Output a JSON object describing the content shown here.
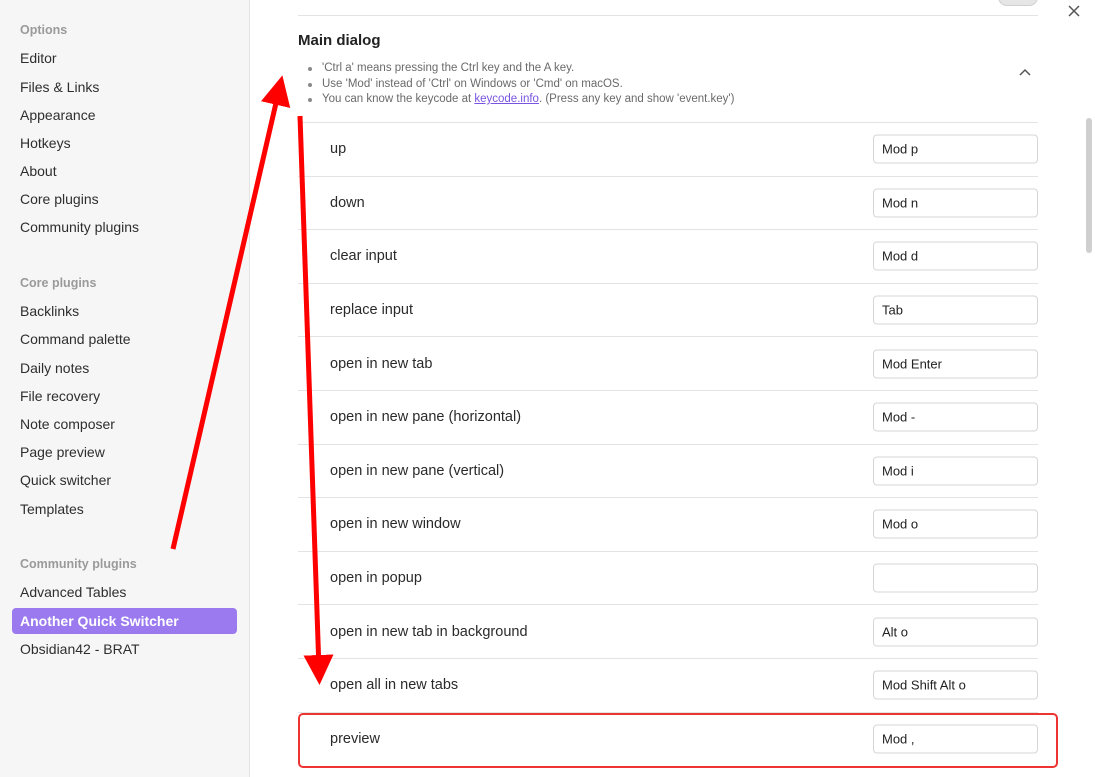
{
  "sidebar": {
    "options_heading": "Options",
    "options": [
      "Editor",
      "Files & Links",
      "Appearance",
      "Hotkeys",
      "About",
      "Core plugins",
      "Community plugins"
    ],
    "core_heading": "Core plugins",
    "core": [
      "Backlinks",
      "Command palette",
      "Daily notes",
      "File recovery",
      "Note composer",
      "Page preview",
      "Quick switcher",
      "Templates"
    ],
    "community_heading": "Community plugins",
    "community": [
      "Advanced Tables",
      "Another Quick Switcher",
      "Obsidian42 - BRAT"
    ],
    "active_item": "Another Quick Switcher"
  },
  "main": {
    "section_title": "Main dialog",
    "notes": {
      "n1": "'Ctrl a' means pressing the Ctrl key and the A key.",
      "n2": "Use 'Mod' instead of 'Ctrl' on Windows or 'Cmd' on macOS.",
      "n3_prefix": "You can know the keycode at ",
      "n3_link": "keycode.info",
      "n3_suffix": ". (Press any key and show 'event.key')"
    },
    "rows": [
      {
        "label": "up",
        "value": "Mod p"
      },
      {
        "label": "down",
        "value": "Mod n"
      },
      {
        "label": "clear input",
        "value": "Mod d"
      },
      {
        "label": "replace input",
        "value": "Tab"
      },
      {
        "label": "open in new tab",
        "value": "Mod Enter"
      },
      {
        "label": "open in new pane (horizontal)",
        "value": "Mod -"
      },
      {
        "label": "open in new pane (vertical)",
        "value": "Mod i"
      },
      {
        "label": "open in new window",
        "value": "Mod o"
      },
      {
        "label": "open in popup",
        "value": ""
      },
      {
        "label": "open in new tab in background",
        "value": "Alt o"
      },
      {
        "label": "open all in new tabs",
        "value": "Mod Shift Alt o"
      },
      {
        "label": "preview",
        "value": "Mod ,"
      }
    ]
  },
  "colors": {
    "accent": "#9b7af0",
    "annotation_red": "#ff0000",
    "highlight_border": "#e33333"
  },
  "icons": {
    "close": "close-icon",
    "chevron": "chevron-up-icon"
  }
}
